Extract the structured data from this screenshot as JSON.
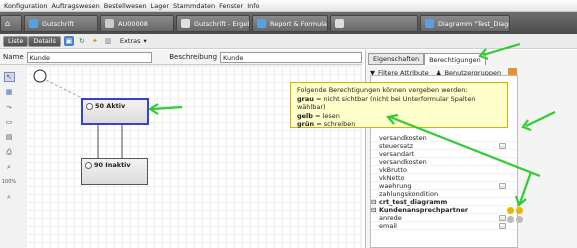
{
  "menubar": [
    "Konfiguration",
    "Auftragswesen",
    "Bestellwesen",
    "Lager",
    "Stammdaten",
    "Fenster",
    "Info"
  ],
  "tabs": [
    {
      "label": "",
      "color": "#ffffff"
    },
    {
      "label": "Gutschrift",
      "color": "#5aa0e0"
    },
    {
      "label": "AU00008",
      "color": "#cccccc"
    },
    {
      "label": "Gutschrift - Ergebnis",
      "color": "#e0e0e0"
    },
    {
      "label": "Report & Formular \"Fo",
      "color": "#5aa0e0"
    },
    {
      "label": "",
      "color": "#dddddd"
    },
    {
      "label": "Diagramm \"Test_Diagr",
      "color": "#5aa0e0"
    }
  ],
  "toolbar": {
    "liste": "Liste",
    "details": "Details",
    "extras": "Extras"
  },
  "form": {
    "name_label": "Name",
    "name_value": "Kunde",
    "desc_label": "Beschreibung",
    "desc_value": "Kunde"
  },
  "states": {
    "active": "50 Aktiv",
    "inactive": "90 Inaktiv"
  },
  "sidetools": {
    "zoom": "100%"
  },
  "right_tabs": {
    "eigenschaften": "Eigenschaften",
    "berechtigungen": "Berechtigungen"
  },
  "right_toolbar": {
    "filter": "Filtere Attribute",
    "perm": "Benutzergruppen"
  },
  "tooltip": {
    "line1": "Folgende Berechtigungen können vergeben werden:",
    "grau": "grau",
    "grau_text": " = nicht sichtbar (nicht bei Unterformular Spalten wählbar)",
    "gelb": "gelb",
    "gelb_text": " = lesen",
    "gruen": "grün",
    "gruen_text": " = schreiben"
  },
  "attrs": [
    {
      "label": "versandkosten",
      "check": false
    },
    {
      "label": "steuersatz",
      "check": true
    },
    {
      "label": "versandart",
      "check": false
    },
    {
      "label": "versandkosten",
      "check": false
    },
    {
      "label": "vkBrutto",
      "check": false
    },
    {
      "label": "vkNetto",
      "check": false
    },
    {
      "label": "waehrung",
      "check": true
    },
    {
      "label": "zahlungskondition",
      "check": false
    }
  ],
  "groups": {
    "g1": "crt_test_diagramm",
    "g2": "Kundenansprechpartner"
  },
  "sub_attrs": [
    "anrede",
    "email"
  ],
  "colors": {
    "gelb": "#e8b800",
    "grau": "#bbbbbb",
    "accent": "#33cc33"
  }
}
